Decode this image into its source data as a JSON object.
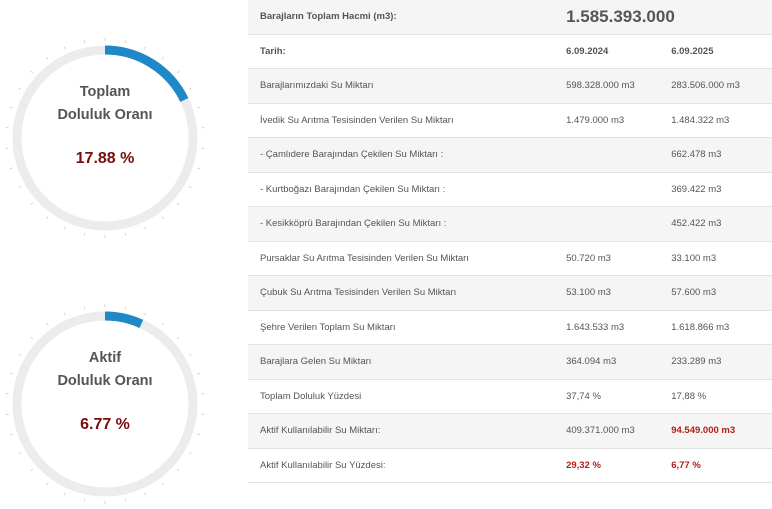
{
  "gauges": [
    {
      "line1": "Toplam",
      "line2": "Doluluk Oranı",
      "value_text": "17.88 %",
      "value": 17.88,
      "color": "#1e88c9"
    },
    {
      "line1": "Aktif",
      "line2": "Doluluk Oranı",
      "value_text": "6.77 %",
      "value": 6.77,
      "color": "#1e88c9"
    }
  ],
  "table": {
    "total_label": "Barajların Toplam Hacmi (m3):",
    "total_value": "1.585.393.000",
    "date_label": "Tarih:",
    "date1": "6.09.2024",
    "date2": "6.09.2025",
    "rows": [
      {
        "label": "Barajlarımızdaki Su Miktarı",
        "v1": "598.328.000 m3",
        "v2": "283.506.000 m3"
      },
      {
        "label": "İvedik Su Arıtma Tesisinden Verilen Su Miktarı",
        "v1": "1.479.000 m3",
        "v2": "1.484.322 m3"
      },
      {
        "label": "- Çamlıdere Barajından Çekilen Su Miktarı :",
        "v1": "",
        "v2": "662.478 m3"
      },
      {
        "label": "- Kurtboğazı Barajından Çekilen Su Miktarı :",
        "v1": "",
        "v2": "369.422 m3"
      },
      {
        "label": "- Kesikköprü Barajından Çekilen Su Miktarı :",
        "v1": "",
        "v2": "452.422 m3"
      },
      {
        "label": "Pursaklar Su Arıtma Tesisinden Verilen Su Miktarı",
        "v1": "50.720 m3",
        "v2": "33.100 m3"
      },
      {
        "label": "Çubuk Su Arıtma Tesisinden Verilen Su Miktarı",
        "v1": "53.100 m3",
        "v2": "57.600 m3"
      },
      {
        "label": "Şehre Verilen Toplam Su Miktarı",
        "v1": "1.643.533 m3",
        "v2": "1.618.866 m3"
      },
      {
        "label": "Barajlara Gelen Su Miktarı",
        "v1": "364.094 m3",
        "v2": "233.289 m3"
      },
      {
        "label": "Toplam Doluluk Yüzdesi",
        "v1": "37,74 %",
        "v2": "17,88 %"
      },
      {
        "label": "Aktif Kullanılabilir Su Miktarı:",
        "v1": "409.371.000 m3",
        "v2": "94.549.000 m3",
        "red2": true
      },
      {
        "label": "Aktif Kullanılabilir Su Yüzdesi:",
        "v1": "29,32 %",
        "v2": "6,77 %",
        "red1": true,
        "red2": true
      }
    ]
  }
}
